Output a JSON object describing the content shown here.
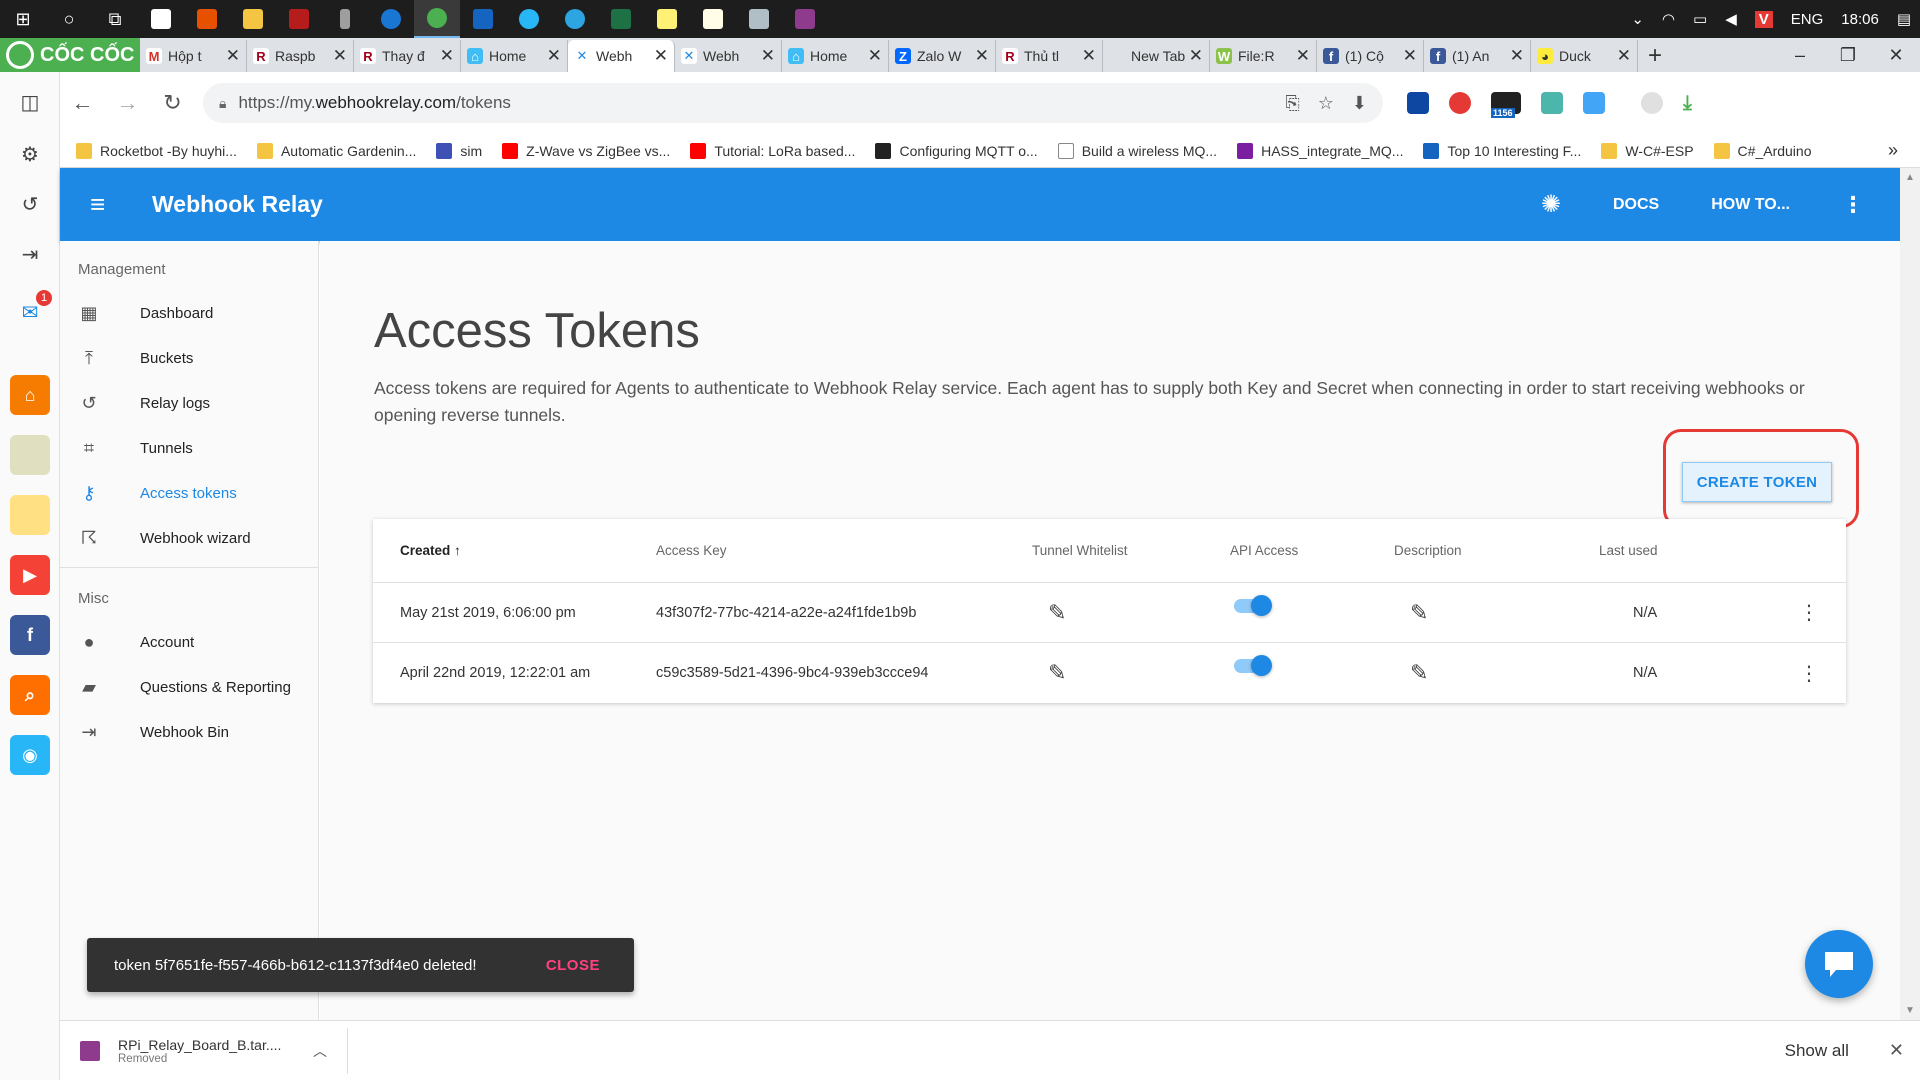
{
  "taskbar": {
    "language": "ENG",
    "time": "18:06"
  },
  "browser": {
    "brand": "CỐC CỐC",
    "tabs": [
      {
        "title": "Hộp t",
        "fav": "M",
        "favcolor": "#ffffff",
        "favtext": "#d93025"
      },
      {
        "title": "Raspb",
        "fav": "R",
        "favcolor": "#ffffff",
        "favtext": "#a4001d"
      },
      {
        "title": "Thay đ",
        "fav": "R",
        "favcolor": "#ffffff",
        "favtext": "#a4001d"
      },
      {
        "title": "Home",
        "fav": "⌂",
        "favcolor": "#41bdf5",
        "favtext": "#ffffff"
      },
      {
        "title": "Webh",
        "fav": "✕",
        "favcolor": "#ffffff",
        "favtext": "#1e88e5",
        "active": true
      },
      {
        "title": "Webh",
        "fav": "✕",
        "favcolor": "#ffffff",
        "favtext": "#1e88e5"
      },
      {
        "title": "Home",
        "fav": "⌂",
        "favcolor": "#41bdf5",
        "favtext": "#ffffff"
      },
      {
        "title": "Zalo W",
        "fav": "Z",
        "favcolor": "#0068ff",
        "favtext": "#ffffff"
      },
      {
        "title": "Thủ tl",
        "fav": "R",
        "favcolor": "#ffffff",
        "favtext": "#a4001d"
      },
      {
        "title": "New Tab",
        "fav": "",
        "favcolor": "transparent",
        "favtext": "#333"
      },
      {
        "title": "File:R",
        "fav": "W",
        "favcolor": "#8bc34a",
        "favtext": "#ffffff"
      },
      {
        "title": "(1) Cộ",
        "fav": "f",
        "favcolor": "#3b5998",
        "favtext": "#ffffff"
      },
      {
        "title": "(1) An",
        "fav": "f",
        "favcolor": "#3b5998",
        "favtext": "#ffffff"
      },
      {
        "title": "Duck",
        "fav": "◕",
        "favcolor": "#ffeb3b",
        "favtext": "#333"
      }
    ],
    "url_scheme": "https://my.",
    "url_host": "webhookrelay.com",
    "url_path": "/tokens",
    "ext_badge": "1156",
    "bookmarks": [
      {
        "label": "Rocketbot -By huyhi...",
        "color": "#f4c542"
      },
      {
        "label": "Automatic Gardenin...",
        "color": "#f4c542"
      },
      {
        "label": "sim",
        "color": "#3f51b5"
      },
      {
        "label": "Z-Wave vs ZigBee vs...",
        "color": "#ff0000"
      },
      {
        "label": "Tutorial: LoRa based...",
        "color": "#ff0000"
      },
      {
        "label": "Configuring MQTT o...",
        "color": "#222222"
      },
      {
        "label": "Build a wireless MQ...",
        "color": "#ffffff"
      },
      {
        "label": "HASS_integrate_MQ...",
        "color": "#7b1fa2"
      },
      {
        "label": "Top 10 Interesting F...",
        "color": "#1565c0"
      },
      {
        "label": "W-C#-ESP",
        "color": "#f4c542"
      },
      {
        "label": "C#_Arduino",
        "color": "#f4c542"
      }
    ],
    "sidebar_badge": "1"
  },
  "app": {
    "title": "Webhook Relay",
    "docs_label": "DOCS",
    "howto_label": "HOW TO...",
    "nav": {
      "management_header": "Management",
      "misc_header": "Misc",
      "management_items": [
        {
          "label": "Dashboard",
          "icon": "▦"
        },
        {
          "label": "Buckets",
          "icon": "⤒"
        },
        {
          "label": "Relay logs",
          "icon": "↺"
        },
        {
          "label": "Tunnels",
          "icon": "⌗"
        },
        {
          "label": "Access tokens",
          "icon": "⚷",
          "active": true
        },
        {
          "label": "Webhook wizard",
          "icon": "☈"
        }
      ],
      "misc_items": [
        {
          "label": "Account",
          "icon": "●"
        },
        {
          "label": "Questions & Reporting",
          "icon": "▰"
        },
        {
          "label": "Webhook Bin",
          "icon": "⇥"
        }
      ]
    },
    "page": {
      "title": "Access Tokens",
      "description": "Access tokens are required for Agents to authenticate to Webhook Relay service. Each agent has to supply both Key and Secret when connecting in order to start receiving webhooks or opening reverse tunnels.",
      "create_button": "CREATE TOKEN"
    },
    "table": {
      "headers": {
        "created": "Created",
        "sort_icon": "↑",
        "access_key": "Access Key",
        "tunnel_whitelist": "Tunnel Whitelist",
        "api_access": "API Access",
        "description": "Description",
        "last_used": "Last used"
      },
      "rows": [
        {
          "created": "May 21st 2019, 6:06:00 pm",
          "access_key": "43f307f2-77bc-4214-a22e-a24f1fde1b9b",
          "api_access": true,
          "last_used": "N/A"
        },
        {
          "created": "April 22nd 2019, 12:22:01 am",
          "access_key": "c59c3589-5d21-4396-9bc4-939eb3ccce94",
          "api_access": true,
          "last_used": "N/A"
        }
      ]
    },
    "snackbar": {
      "message": "token 5f7651fe-f557-466b-b612-c1137f3df4e0 deleted!",
      "close_label": "CLOSE"
    }
  },
  "download": {
    "filename": "RPi_Relay_Board_B.tar....",
    "status": "Removed",
    "show_all": "Show all"
  },
  "colors": {
    "primary": "#1e88e5",
    "highlight_red": "#e53935",
    "snackbar_accent": "#ff4081"
  }
}
